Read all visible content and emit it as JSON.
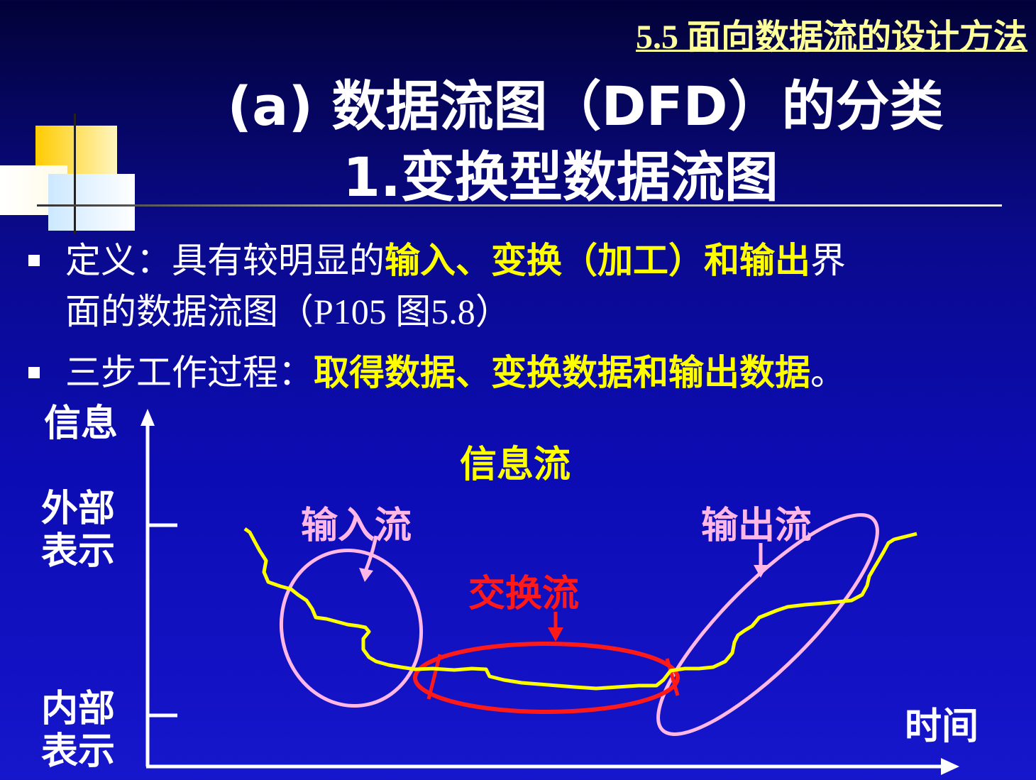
{
  "section_title": "5.5 面向数据流的设计方法",
  "title_line1": "(a)  数据流图（DFD）的分类",
  "title_line2": "1.变换型数据流图",
  "bullets": [
    {
      "prefix": "定义：具有较明显的",
      "highlight": "输入、变换（加工）和输出",
      "suffix": "界",
      "line2_text": "面的数据流图（",
      "line2_ref": "P105 图5.8",
      "line2_end": "）"
    },
    {
      "prefix": "三步工作过程：",
      "highlight": "取得数据、变换数据和输出数据",
      "suffix": "。"
    }
  ],
  "diagram": {
    "y_axis_label": "信息",
    "x_axis_label": "时间",
    "level_external": [
      "外部",
      "表示"
    ],
    "level_internal": [
      "内部",
      "表示"
    ],
    "info_flow_label": "信息流",
    "input_flow_label": "输入流",
    "output_flow_label": "输出流",
    "transform_flow_label": "交换流"
  },
  "colors": {
    "background": "#0a0a8c",
    "highlight_yellow": "#ffff00",
    "section_title": "#ffff99",
    "pink_labels": "#ffb0e0",
    "red_transform": "#ff1a1a",
    "curve_yellow": "#ffff00"
  }
}
